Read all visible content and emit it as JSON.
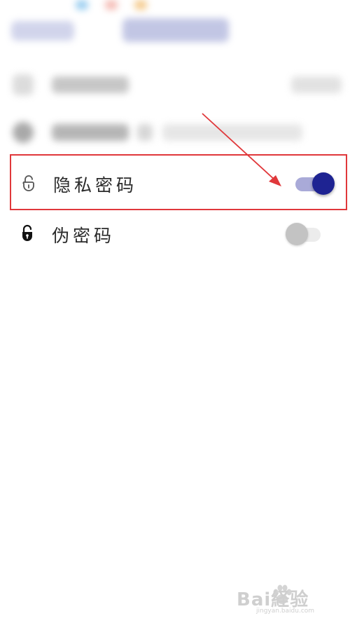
{
  "colors": {
    "highlight_border": "#e0383b",
    "toggle_on": "#1e2392",
    "toggle_on_track": "#a9aad8",
    "toggle_off": "#c3c3c3",
    "arrow": "#e0383b"
  },
  "settings": {
    "items": [
      {
        "label": "隐私密码",
        "icon": "unlocked-padlock-outline-icon",
        "enabled": true
      },
      {
        "label": "伪密码",
        "icon": "unlocked-padlock-filled-icon",
        "enabled": false
      }
    ]
  },
  "watermark": {
    "text": "Bai経验",
    "sub": "jingyan.baidu.com"
  }
}
